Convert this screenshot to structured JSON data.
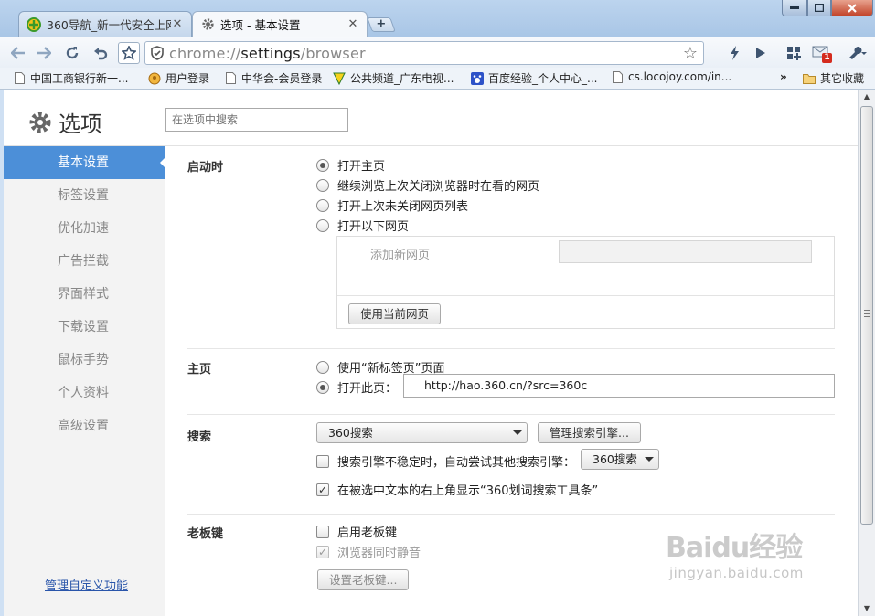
{
  "tabs": [
    {
      "title": "360导航_新一代安全上网",
      "close": "✕"
    },
    {
      "title": "选项 - 基本设置",
      "close": "✕"
    }
  ],
  "new_tab_label": "+",
  "omnibox": {
    "scheme": "chrome://",
    "host": "settings",
    "path": "/browser"
  },
  "bookmarks": [
    "中国工商银行新一...",
    "用户登录",
    "中华会-会员登录",
    "公共频道_广东电视...",
    "百度经验_个人中心_...",
    "cs.locojoy.com/in..."
  ],
  "bookmarks_more": "»",
  "bookmarks_other": "其它收藏",
  "mail_badge": "1",
  "header": {
    "title": "选项",
    "search_placeholder": "在选项中搜索"
  },
  "sidebar": {
    "items": [
      "基本设置",
      "标签设置",
      "优化加速",
      "广告拦截",
      "界面样式",
      "下载设置",
      "鼠标手势",
      "个人资料",
      "高级设置"
    ],
    "selected": 0,
    "custom_link": "管理自定义功能"
  },
  "startup": {
    "title": "启动时",
    "options": [
      "打开主页",
      "继续浏览上次关闭浏览器时在看的网页",
      "打开上次未关闭网页列表",
      "打开以下网页"
    ],
    "selected": 0,
    "add_page_label": "添加新网页",
    "use_current_button": "使用当前网页"
  },
  "homepage": {
    "title": "主页",
    "option_newtab": "使用“新标签页”页面",
    "option_open": "打开此页：",
    "url": "http://hao.360.cn/?src=360c"
  },
  "search": {
    "title": "搜索",
    "engine": "360搜索",
    "manage_button": "管理搜索引擎...",
    "fallback_label": "搜索引擎不稳定时，自动尝试其他搜索引擎：",
    "fallback_engine": "360搜索",
    "toolbar_label": "在被选中文本的右上角显示“360划词搜索工具条”"
  },
  "boss_key": {
    "title": "老板键",
    "enable_label": "启用老板键",
    "mute_label": "浏览器同时静音",
    "set_button": "设置老板键..."
  },
  "watermark": {
    "text": "Baidu经验",
    "sub": "jingyan.baidu.com"
  },
  "colors": {
    "selected_nav": "#4c8fd8",
    "link": "#2955aa",
    "close_button": "#c2452b"
  }
}
